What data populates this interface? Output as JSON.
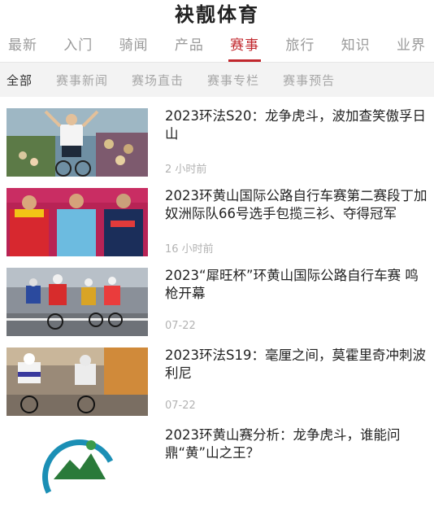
{
  "app": {
    "title": "袂靓体育"
  },
  "main_tabs": [
    {
      "label": "最新"
    },
    {
      "label": "入门"
    },
    {
      "label": "骑闻"
    },
    {
      "label": "产品"
    },
    {
      "label": "赛事",
      "active": true
    },
    {
      "label": "旅行"
    },
    {
      "label": "知识"
    },
    {
      "label": "业界"
    }
  ],
  "sub_tabs": [
    {
      "label": "全部",
      "active": true
    },
    {
      "label": "赛事新闻"
    },
    {
      "label": "赛场直击"
    },
    {
      "label": "赛事专栏"
    },
    {
      "label": "赛事预告"
    }
  ],
  "articles": [
    {
      "title": "2023环法S20：龙争虎斗，波加查笑傲孚日山",
      "time": "2 小时前"
    },
    {
      "title": "2023环黄山国际公路自行车赛第二赛段丁加奴洲际队66号选手包揽三衫、夺得冠军",
      "time": "16 小时前"
    },
    {
      "title": "2023“犀旺杯”环黄山国际公路自行车赛 鸣枪开幕",
      "time": "07-22"
    },
    {
      "title": "2023环法S19：毫厘之间，莫霍里奇冲刺波利尼",
      "time": "07-22"
    },
    {
      "title": "2023环黄山赛分析：龙争虎斗，谁能问鼎“黄”山之王？",
      "time": ""
    }
  ],
  "colors": {
    "accent": "#c1272d",
    "subbar_bg": "#f3f3f3"
  }
}
